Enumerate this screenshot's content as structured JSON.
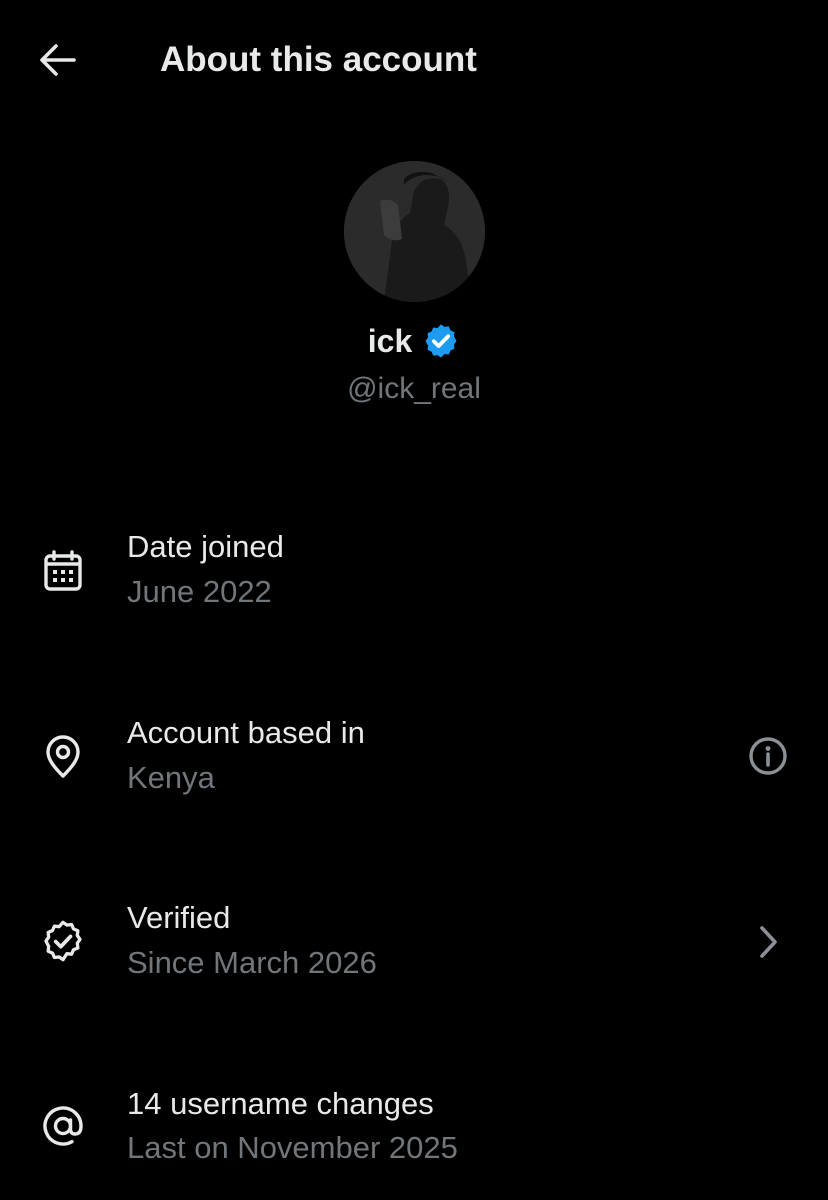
{
  "header": {
    "title": "About this account",
    "back_icon": "arrow-left-icon"
  },
  "profile": {
    "display_name": "ick",
    "handle": "@ick_real",
    "verified_badge_color": "#1d9bf0"
  },
  "rows": [
    {
      "icon": "calendar-icon",
      "title": "Date joined",
      "subtitle": "June 2022"
    },
    {
      "icon": "location-pin-icon",
      "title": "Account based in",
      "subtitle": "Kenya",
      "action_icon": "info-icon"
    },
    {
      "icon": "verified-badge-icon",
      "title": "Verified",
      "subtitle": "Since March 2026",
      "action_icon": "chevron-right-icon"
    },
    {
      "icon": "at-sign-icon",
      "title": "14 username changes",
      "subtitle": "Last on November 2025"
    }
  ],
  "colors": {
    "background": "#000000",
    "primary_text": "#e7e9ea",
    "secondary_text": "#71767b",
    "accent": "#1d9bf0"
  }
}
